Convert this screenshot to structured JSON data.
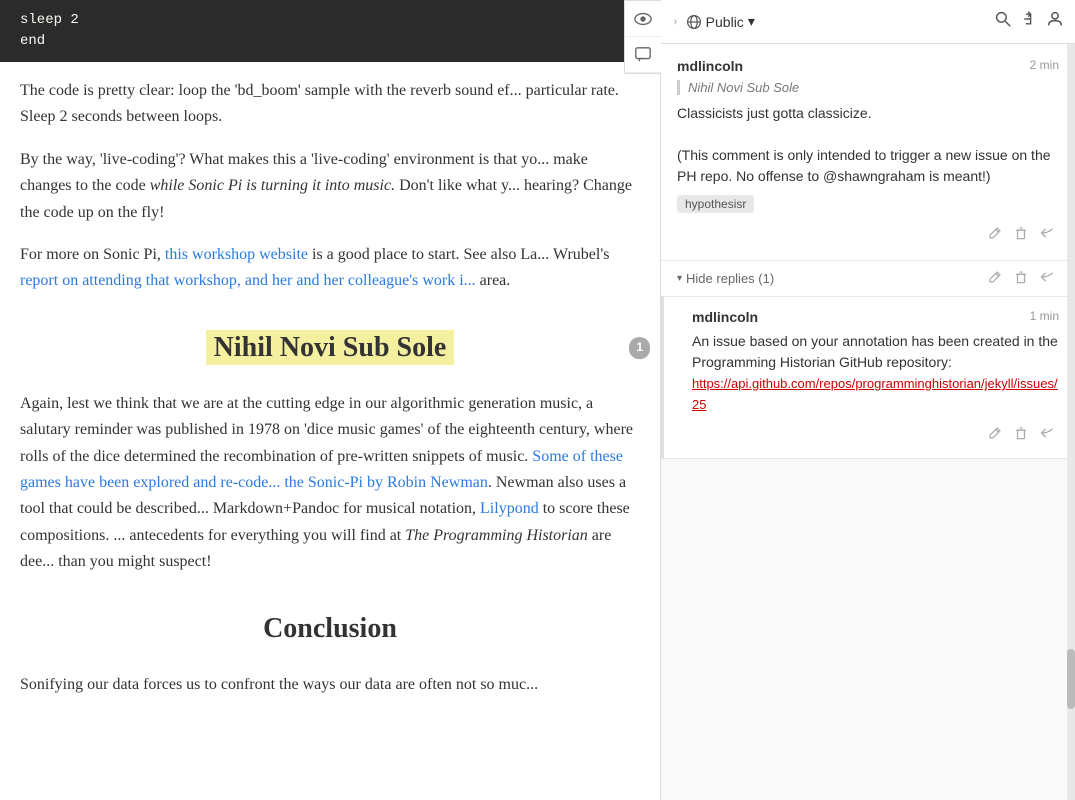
{
  "code": {
    "line1": "sleep 2",
    "line2": "end"
  },
  "article": {
    "para1": "The code is pretty clear: loop the 'bd_boom' sample with the reverb sound ef... particular rate. Sleep 2 seconds between loops.",
    "para2": "By the way, 'live-coding'? What makes this a 'live-coding' environment is that yo... make changes to the code while Sonic Pi is turning it into music. Don't like what y... hearing? Change the code up on the fly!",
    "para2_italic": "while Sonic Pi is turning it into music.",
    "para3_prefix": "For more on Sonic Pi,",
    "para3_link1": "this workshop website",
    "para3_mid": "is a good place to start. See also La... Wrubel's",
    "para3_link2": "report on attending that workshop, and her and her colleague's work i...",
    "para3_suffix": "area.",
    "section1_title": "Nihil Novi Sub Sole",
    "section1_badge": "1",
    "para4": "Again, lest we think that we are at the cutting edge in our algorithmic generation music, a salutary reminder was published in 1978 on 'dice music games' of the eighteenth century, where rolls of the dice determined the recombination of pre-written snippets of music.",
    "para4_link": "Some of these games have been explored and re-code... the Sonic-Pi by Robin Newman",
    "para4_cont": ". Newman also uses a tool that could be described... Markdown+Pandoc for musical notation,",
    "para4_link2": "Lilypond",
    "para4_end": "to score these compositions. ... antecedents for everything you will find at",
    "para4_italic": "The Programming Historian",
    "para4_final": "are dee... than you might suspect!",
    "conclusion_title": "Conclusion",
    "last_para": "Sonifying our data forces us to confront the ways our data are often not so muc..."
  },
  "toolbar": {
    "chevron": "›",
    "public_label": "Public",
    "dropdown_icon": "▾",
    "search_icon": "🔍",
    "share_icon": "⬆",
    "user_icon": "👤"
  },
  "annotations": [
    {
      "id": "annotation-1",
      "user": "mdlincoln",
      "time": "2 min",
      "quote": "Nihil Novi Sub Sole",
      "body": "Classicists just gotta classicize.\n\n(This comment is only intended to trigger a new issue on the PH repo. No offense to @shawngraham is meant!)",
      "tag": "hypothesisr",
      "actions": [
        "edit",
        "delete",
        "reply"
      ],
      "hide_replies_label": "Hide replies (1)",
      "replies": [
        {
          "id": "reply-1",
          "user": "mdlincoln",
          "time": "1 min",
          "body": "An issue based on your annotation has been created in the Programming Historian GitHub repository:",
          "link": "https://api.github.com/repos/programminghistorian/jekyll/issues/25",
          "actions": [
            "edit",
            "delete",
            "reply"
          ]
        }
      ]
    }
  ],
  "side_tools": {
    "eye_icon": "👁",
    "comment_icon": "💬"
  }
}
